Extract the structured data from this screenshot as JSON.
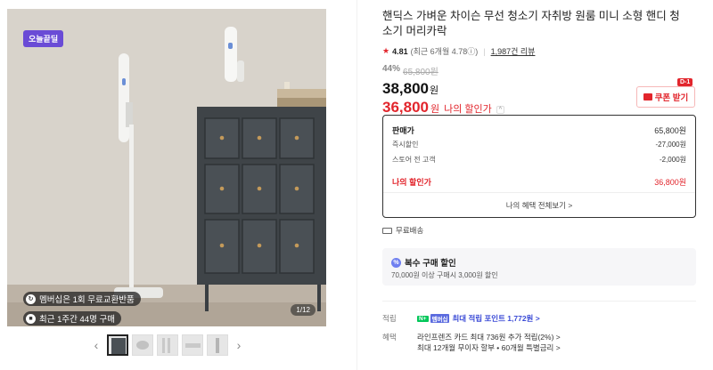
{
  "gallery": {
    "badge_today": "오늘끝딜",
    "pill_membership": "멤버십은 1회 무료교환반품",
    "pill_recent": "최근 1주간 44명 구매",
    "page_counter": "1/12",
    "prev_icon": "chevron-left-icon",
    "next_icon": "chevron-right-icon",
    "thumbnail_count": 5
  },
  "product": {
    "title": "핸딕스 가벼운 차이슨 무선 청소기 자취방 원룸 미니 소형 핸디 청소기 머리카락",
    "rating": "4.81",
    "rating_detail": "(최근 6개월 4.78ⓘ)",
    "reviews": "1,987건 리뷰",
    "discount_pct": "44%",
    "original_price": "65,800원",
    "price": "38,800",
    "price_unit": "원",
    "my_price": "36,800",
    "my_price_unit": "원",
    "my_price_label": "나의 할인가",
    "caret": "^"
  },
  "coupon": {
    "badge": "D-1",
    "label": "쿠폰 받기"
  },
  "price_breakdown": {
    "rows": [
      {
        "label": "판매가",
        "value": "65,800원"
      },
      {
        "label": "즉시할인",
        "value": "-27,000원"
      },
      {
        "label": "스토어 전 고객",
        "value": "-2,000원"
      },
      {
        "label": "나의 할인가",
        "value": "36,800원"
      }
    ],
    "more_label": "나의 혜택 전체보기 >"
  },
  "shipping": {
    "label": "무료배송"
  },
  "multi_buy": {
    "title": "복수 구매 할인",
    "desc": "70,000원 이상 구매시 3,000원 할인"
  },
  "benefits": {
    "points_label": "적립",
    "points_badge_1": "N+",
    "points_badge_2": "멤버십",
    "points_link": "최대 적립 포인트 1,772원 >",
    "card_label": "혜택",
    "card_line_1": "라인프렌즈 카드 최대 736원 추가 적립(2%) >",
    "card_line_2": "최대 12개월 무이자 할부 • 60개월 특별금리 >"
  },
  "colors": {
    "accent_red": "#e2252c",
    "badge_purple": "#6a4bd6",
    "link_blue": "#3b4bd6",
    "naver_green": "#03c75a"
  }
}
